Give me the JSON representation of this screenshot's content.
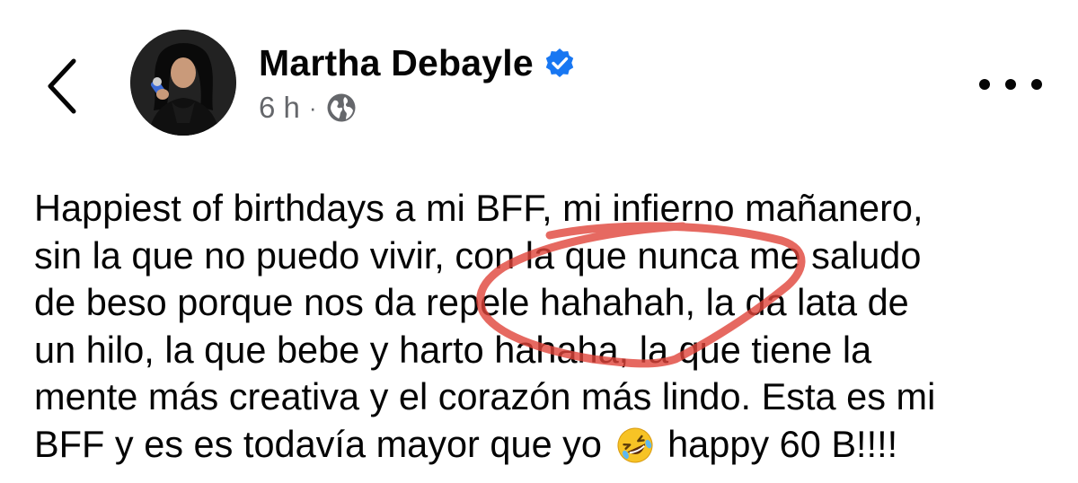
{
  "header": {
    "back_icon": "chevron-left-icon",
    "author_name": "Martha Debayle",
    "verified_icon": "verified-badge-icon",
    "timestamp": "6 h",
    "separator": "·",
    "audience_icon": "globe-icon",
    "more_icon": "more-horizontal-icon"
  },
  "post": {
    "lines": [
      "Happiest of birthdays a mi BFF, mi infierno mañanero,",
      "sin la que no puedo vivir, con la que nunca me saludo",
      "de beso porque nos da repele hahahah, la da lata de",
      "un hilo, la que bebe y harto hahaha, la que tiene la",
      "mente más creativa y el corazón más lindo. Esta es mi"
    ],
    "last_line_before_emoji": "BFF y es es todavía mayor que yo",
    "emoji": "rolling-on-floor-laughing-icon",
    "last_line_after_emoji": "happy 60 B!!!!"
  },
  "colors": {
    "verified": "#1877f2",
    "meta": "#65676b",
    "annotation": "#e0443a",
    "text": "#050505"
  }
}
